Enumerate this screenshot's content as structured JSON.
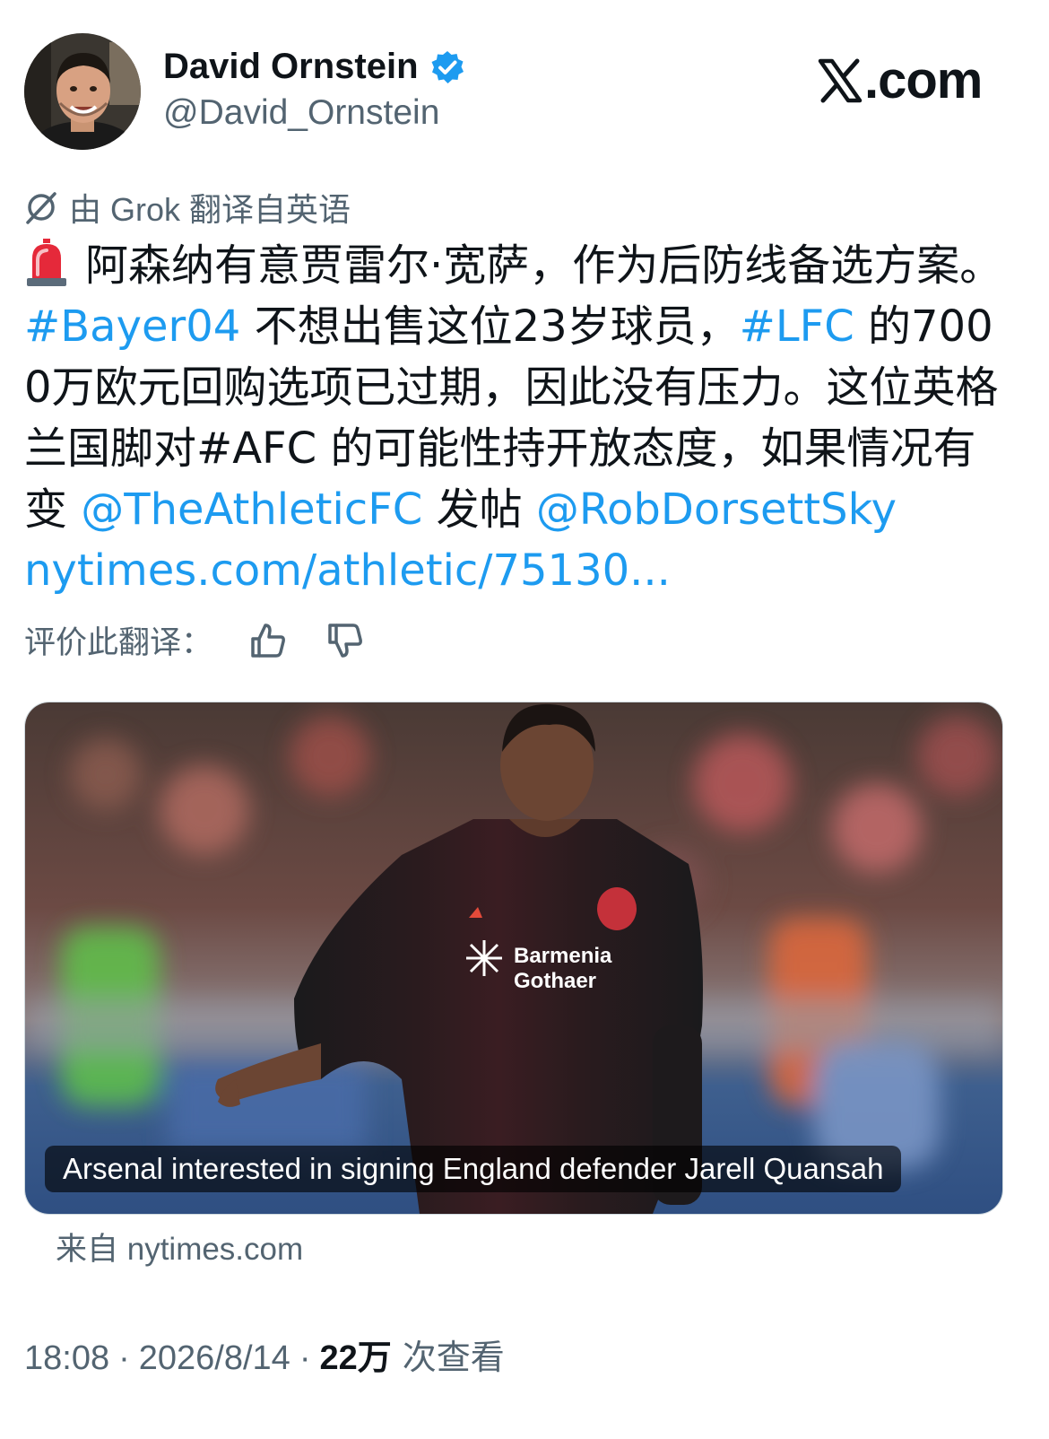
{
  "author": {
    "name": "David Ornstein",
    "handle": "@David_Ornstein",
    "verified": true
  },
  "brand": "X.com",
  "translation_note": "由 Grok 翻译自英语",
  "tweet": {
    "emoji": "rotating-light-icon",
    "t1": "阿森纳有意贾雷尔·宽萨，作为后防线备选方案。",
    "tag_bayer": "#Bayer04",
    "t2": " 不想出售这位23岁球员，",
    "tag_lfc": "#LFC",
    "t3": " 的7000万欧元回购选项已过期，因此没有压力。这位英格兰国脚对#AFC 的可能性持开放态度，如果情况有变 ",
    "mention_athletic": "@TheAthleticFC",
    "t4": " 发帖 ",
    "mention_rob": "@RobDorsettSky",
    "url": "nytimes.com/athletic/75130..."
  },
  "rate_translation_label": "评价此翻译：",
  "card": {
    "caption": "Arsenal interested in signing England defender Jarell Quansah",
    "source": "来自 nytimes.com",
    "shirt_sponsor": "Barmenia Gothaer"
  },
  "footer": {
    "time": "18:08",
    "date": "2026/8/14",
    "views": "22万",
    "views_label": "次查看",
    "separator": "·"
  },
  "colors": {
    "link": "#1d9bf0",
    "secondary_text": "#536471",
    "verified": "#1d9bf0"
  }
}
